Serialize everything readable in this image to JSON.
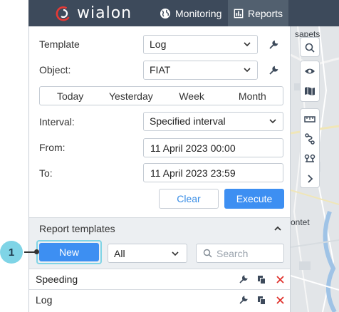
{
  "header": {
    "brand": "wialon",
    "nav": [
      {
        "label": "Monitoring",
        "icon": "globe-icon"
      },
      {
        "label": "Reports",
        "icon": "report-icon",
        "active": true
      }
    ]
  },
  "form": {
    "template_label": "Template",
    "template_value": "Log",
    "object_label": "Object:",
    "object_value": "FIAT",
    "periods": [
      "Today",
      "Yesterday",
      "Week",
      "Month"
    ],
    "interval_label": "Interval:",
    "interval_value": "Specified interval",
    "from_label": "From:",
    "from_value": "11 April 2023 00:00",
    "to_label": "To:",
    "to_value": "11 April 2023 23:59",
    "clear_label": "Clear",
    "execute_label": "Execute"
  },
  "templates": {
    "title": "Report templates",
    "new_label": "New",
    "filter_value": "All",
    "search_placeholder": "Search",
    "rows": [
      {
        "name": "Speeding"
      },
      {
        "name": "Log"
      }
    ]
  },
  "map": {
    "labels": [
      "sapets",
      "ontet"
    ]
  },
  "callout": {
    "number": "1"
  },
  "colors": {
    "header_bg": "#3d4a5b",
    "accent": "#3d8ff2",
    "delete": "#e0322d",
    "callout": "#7fd4e6"
  }
}
